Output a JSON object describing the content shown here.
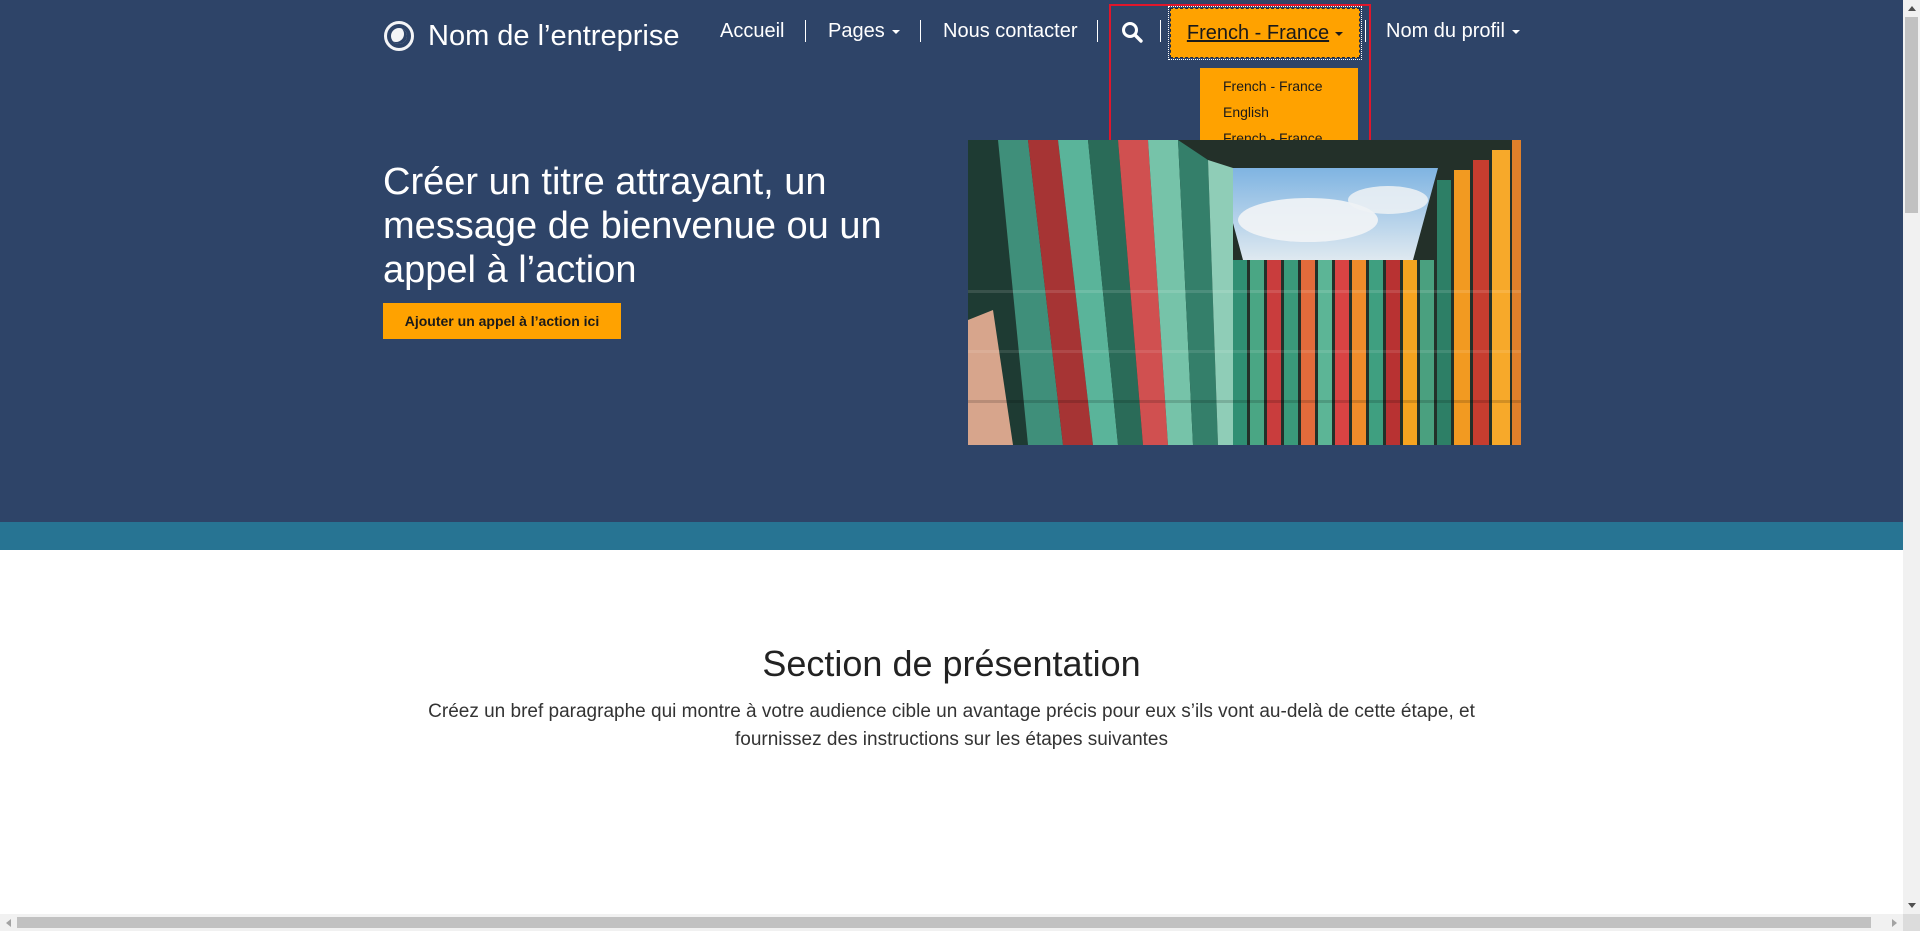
{
  "header": {
    "brand_name": "Nom de l’entreprise",
    "nav": {
      "home": "Accueil",
      "pages": "Pages",
      "contact": "Nous contacter",
      "profile": "Nom du profil"
    },
    "search_icon": "search-icon",
    "language": {
      "selected": "French - France",
      "options": [
        "French - France",
        "English",
        "French - France"
      ]
    }
  },
  "hero": {
    "title": "Créer un titre attrayant, un message de bienvenue ou un appel à l’action",
    "cta_label": "Ajouter un appel à l’action ici"
  },
  "presentation": {
    "title": "Section de présentation",
    "text": "Créez un bref paragraphe qui montre à votre audience cible un avantage précis pour eux s’ils vont au-delà de cette étape, et fournissez des instructions sur les étapes suivantes"
  },
  "colors": {
    "hero_background": "#2e4468",
    "accent": "#ffa200",
    "teal_strip": "#277493",
    "highlight": "#e0162b"
  }
}
